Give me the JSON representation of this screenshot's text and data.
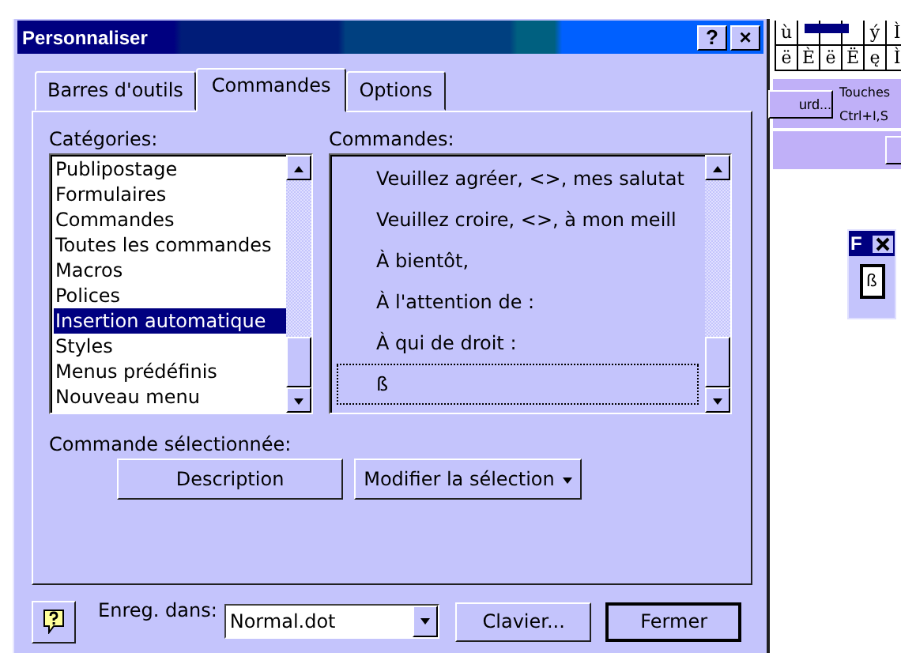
{
  "window": {
    "title": "Personnaliser",
    "title_buttons": [
      "?",
      "×"
    ]
  },
  "tabs": [
    {
      "label": "Barres d'outils",
      "selected": false
    },
    {
      "label": "Commandes",
      "selected": true
    },
    {
      "label": "Options",
      "selected": false
    }
  ],
  "categories": {
    "label": "Catégories:",
    "items": [
      {
        "label": "Publipostage",
        "selected": false
      },
      {
        "label": "Formulaires",
        "selected": false
      },
      {
        "label": "Commandes",
        "selected": false
      },
      {
        "label": "Toutes les commandes",
        "selected": false
      },
      {
        "label": "Macros",
        "selected": false
      },
      {
        "label": "Polices",
        "selected": false
      },
      {
        "label": "Insertion automatique",
        "selected": true
      },
      {
        "label": "Styles",
        "selected": false
      },
      {
        "label": "Menus prédéfinis",
        "selected": false
      },
      {
        "label": "Nouveau menu",
        "selected": false
      }
    ]
  },
  "commands": {
    "label": "Commandes:",
    "items": [
      {
        "label": "Veuillez agréer, <>, mes salutat",
        "focused": false
      },
      {
        "label": "Veuillez croire, <>, à mon meill",
        "focused": false
      },
      {
        "label": "À bientôt,",
        "focused": false
      },
      {
        "label": "À l'attention de :",
        "focused": false
      },
      {
        "label": "À qui de droit :",
        "focused": false
      },
      {
        "label": "ß",
        "focused": true
      }
    ]
  },
  "selected_command": {
    "label": "Commande sélectionnée:",
    "buttons": [
      {
        "label": "Description",
        "kind": "button"
      },
      {
        "label": "Modifier la sélection",
        "kind": "menu"
      }
    ]
  },
  "footer": {
    "save_in": {
      "label": "Enreg. dans:",
      "value": "Normal.dot"
    },
    "buttons": [
      {
        "label": "Clavier...",
        "default": false
      },
      {
        "label": "Fermer",
        "default": true
      }
    ]
  },
  "background": {
    "char_rows": [
      [
        "ù",
        "",
        "",
        "",
        "ý",
        "Ì"
      ],
      [
        "ë",
        "È",
        "ë",
        "Ë",
        "ę",
        "Ì"
      ]
    ],
    "button": "urd...",
    "texts": [
      "Touches",
      "Ctrl+I,S"
    ],
    "mini_toolbar": {
      "title": "F",
      "button": "ß"
    }
  }
}
